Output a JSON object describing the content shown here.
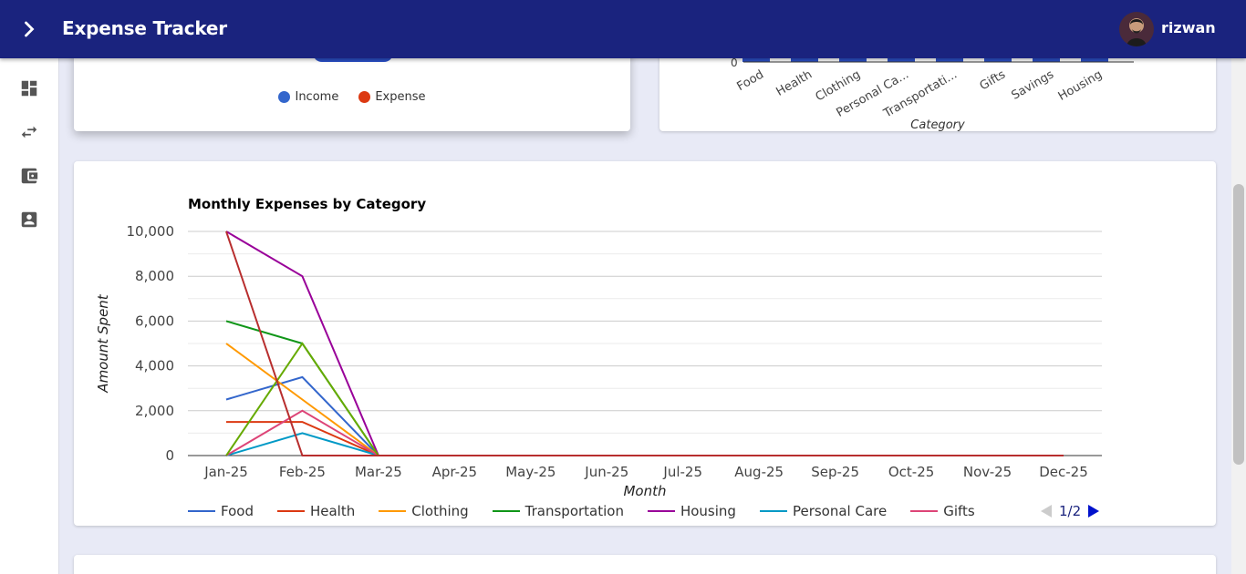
{
  "app": {
    "title": "Expense Tracker",
    "username": "rizwan"
  },
  "sidebar": {
    "items": [
      {
        "icon": "dashboard-icon"
      },
      {
        "icon": "transactions-icon"
      },
      {
        "icon": "wallet-icon"
      },
      {
        "icon": "account-icon"
      }
    ]
  },
  "pie_card": {
    "legend": [
      {
        "label": "Income",
        "color": "#3366cc"
      },
      {
        "label": "Expense",
        "color": "#dc3912"
      }
    ]
  },
  "bar_card": {
    "categories": [
      "Food",
      "Health",
      "Clothing",
      "Personal Ca...",
      "Transportati...",
      "Gifts",
      "Savings",
      "Housing"
    ],
    "zero_tick": "0",
    "xlabel": "Category"
  },
  "chart_data": {
    "type": "line",
    "title": "Monthly Expenses by Category",
    "xlabel": "Month",
    "ylabel": "Amount Spent",
    "ylim": [
      0,
      10000
    ],
    "yticks": [
      "10,000",
      "8,000",
      "6,000",
      "4,000",
      "2,000",
      "0"
    ],
    "categories": [
      "Jan-25",
      "Feb-25",
      "Mar-25",
      "Apr-25",
      "May-25",
      "Jun-25",
      "Jul-25",
      "Aug-25",
      "Sep-25",
      "Oct-25",
      "Nov-25",
      "Dec-25"
    ],
    "series": [
      {
        "name": "Food",
        "color": "#3366cc",
        "values": [
          2500,
          3500,
          0,
          0,
          0,
          0,
          0,
          0,
          0,
          0,
          0,
          0
        ]
      },
      {
        "name": "Health",
        "color": "#dc3912",
        "values": [
          1500,
          1500,
          0,
          0,
          0,
          0,
          0,
          0,
          0,
          0,
          0,
          0
        ]
      },
      {
        "name": "Clothing",
        "color": "#ff9900",
        "values": [
          5000,
          2500,
          0,
          0,
          0,
          0,
          0,
          0,
          0,
          0,
          0,
          0
        ]
      },
      {
        "name": "Transportation",
        "color": "#109618",
        "values": [
          6000,
          5000,
          0,
          0,
          0,
          0,
          0,
          0,
          0,
          0,
          0,
          0
        ]
      },
      {
        "name": "Housing",
        "color": "#990099",
        "values": [
          10000,
          8000,
          0,
          0,
          0,
          0,
          0,
          0,
          0,
          0,
          0,
          0
        ]
      },
      {
        "name": "Personal Care",
        "color": "#0099c6",
        "values": [
          0,
          1000,
          0,
          0,
          0,
          0,
          0,
          0,
          0,
          0,
          0,
          0
        ]
      },
      {
        "name": "Gifts",
        "color": "#dd4477",
        "values": [
          0,
          2000,
          0,
          0,
          0,
          0,
          0,
          0,
          0,
          0,
          0,
          0
        ]
      },
      {
        "color": "#66aa00",
        "values": [
          0,
          5000,
          0,
          0,
          0,
          0,
          0,
          0,
          0,
          0,
          0,
          0
        ]
      },
      {
        "color": "#b82e2e",
        "values": [
          10000,
          0,
          0,
          0,
          0,
          0,
          0,
          0,
          0,
          0,
          0,
          0
        ]
      }
    ],
    "legend_visible": [
      "Food",
      "Health",
      "Clothing",
      "Transportation",
      "Housing",
      "Personal Care",
      "Gifts"
    ],
    "legend_placement": "bottom",
    "grid": true
  },
  "pager": {
    "text": "1/2"
  }
}
